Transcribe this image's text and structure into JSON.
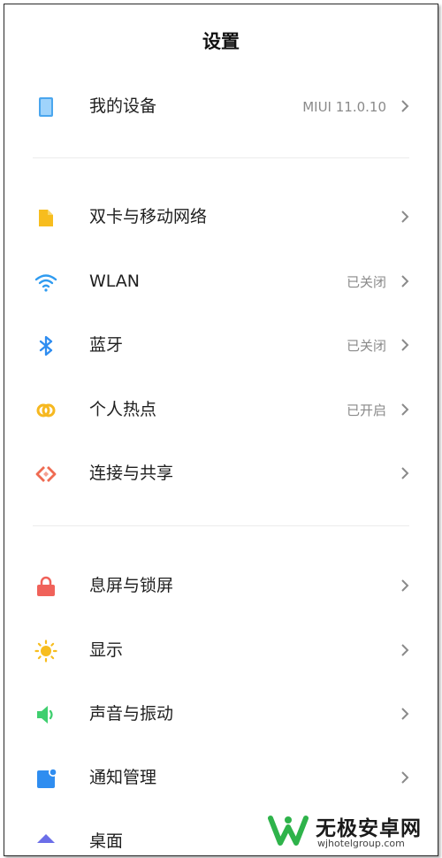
{
  "header": {
    "title": "设置"
  },
  "items": [
    {
      "label": "我的设备",
      "status": "MIUI 11.0.10",
      "icon": "tablet-icon",
      "color": "#4aa6ee"
    },
    {
      "label": "双卡与移动网络",
      "status": "",
      "icon": "sim-card-icon",
      "color": "#f7bd1e"
    },
    {
      "label": "WLAN",
      "status": "已关闭",
      "icon": "wifi-icon",
      "color": "#2f9bf0"
    },
    {
      "label": "蓝牙",
      "status": "已关闭",
      "icon": "bluetooth-icon",
      "color": "#2f8df0"
    },
    {
      "label": "个人热点",
      "status": "已开启",
      "icon": "hotspot-icon",
      "color": "#f6b820"
    },
    {
      "label": "连接与共享",
      "status": "",
      "icon": "connection-share-icon",
      "color": "#ef6b52"
    },
    {
      "label": "息屏与锁屏",
      "status": "",
      "icon": "lock-icon",
      "color": "#f0625a"
    },
    {
      "label": "显示",
      "status": "",
      "icon": "sun-icon",
      "color": "#f7bd1e"
    },
    {
      "label": "声音与振动",
      "status": "",
      "icon": "speaker-icon",
      "color": "#3fcf6f"
    },
    {
      "label": "通知管理",
      "status": "",
      "icon": "notification-icon",
      "color": "#2f8df0"
    },
    {
      "label": "桌面",
      "status": "",
      "icon": "desktop-icon",
      "color": "#6b6ee8"
    }
  ],
  "watermark": {
    "name": "无极安卓网",
    "url": "wjhotelgroup.com",
    "logo_color": "#2eb34a"
  }
}
